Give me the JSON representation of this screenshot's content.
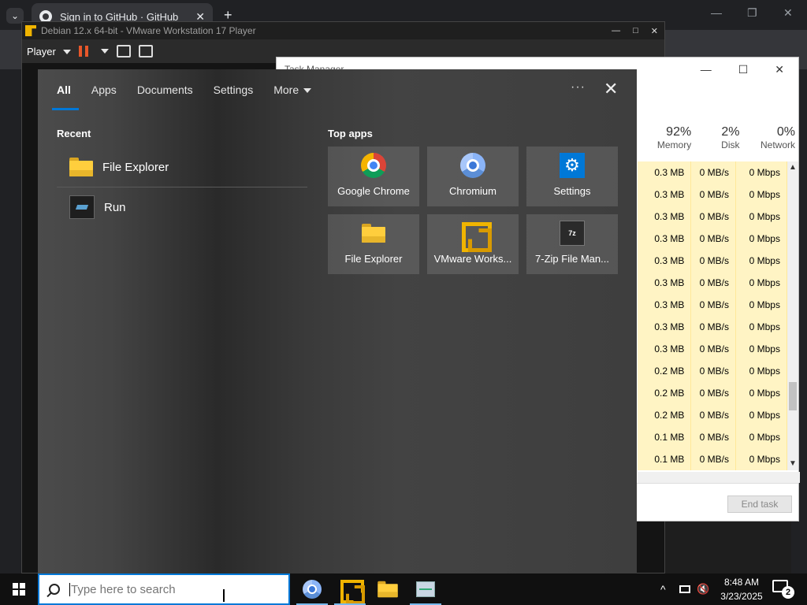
{
  "chrome": {
    "tab_title": "Sign in to GitHub · GitHub",
    "tab_close": "✕",
    "new_tab": "+",
    "tab_menu": "⌄",
    "minimize": "—",
    "restore": "❐",
    "close": "✕"
  },
  "vmware": {
    "title": "Debian 12.x 64-bit - VMware Workstation 17 Player",
    "player_menu": "Player",
    "minimize": "—",
    "maximize": "□",
    "close": "✕"
  },
  "task_manager": {
    "title": "Task Manager",
    "minimize": "—",
    "maximize": "☐",
    "close": "✕",
    "columns": [
      {
        "pct": "92%",
        "name": "Memory"
      },
      {
        "pct": "2%",
        "name": "Disk"
      },
      {
        "pct": "0%",
        "name": "Network"
      }
    ],
    "rows": [
      [
        "0.3 MB",
        "0 MB/s",
        "0 Mbps"
      ],
      [
        "0.3 MB",
        "0 MB/s",
        "0 Mbps"
      ],
      [
        "0.3 MB",
        "0 MB/s",
        "0 Mbps"
      ],
      [
        "0.3 MB",
        "0 MB/s",
        "0 Mbps"
      ],
      [
        "0.3 MB",
        "0 MB/s",
        "0 Mbps"
      ],
      [
        "0.3 MB",
        "0 MB/s",
        "0 Mbps"
      ],
      [
        "0.3 MB",
        "0 MB/s",
        "0 Mbps"
      ],
      [
        "0.3 MB",
        "0 MB/s",
        "0 Mbps"
      ],
      [
        "0.3 MB",
        "0 MB/s",
        "0 Mbps"
      ],
      [
        "0.2 MB",
        "0 MB/s",
        "0 Mbps"
      ],
      [
        "0.2 MB",
        "0 MB/s",
        "0 Mbps"
      ],
      [
        "0.2 MB",
        "0 MB/s",
        "0 Mbps"
      ],
      [
        "0.1 MB",
        "0 MB/s",
        "0 Mbps"
      ],
      [
        "0.1 MB",
        "0 MB/s",
        "0 Mbps"
      ]
    ],
    "end_task": "End task"
  },
  "start": {
    "tabs": [
      "All",
      "Apps",
      "Documents",
      "Settings",
      "More"
    ],
    "more_dots": "···",
    "close": "✕",
    "recent_title": "Recent",
    "recent": [
      {
        "label": "File Explorer",
        "icon": "folder-icon"
      },
      {
        "label": "Run",
        "icon": "run-icon"
      }
    ],
    "top_apps_title": "Top apps",
    "top_apps": [
      {
        "label": "Google Chrome",
        "icon": "chrome-icon"
      },
      {
        "label": "Chromium",
        "icon": "chromium-icon"
      },
      {
        "label": "Settings",
        "icon": "gear-icon"
      },
      {
        "label": "File Explorer",
        "icon": "folder-icon"
      },
      {
        "label": "VMware Works...",
        "icon": "vmware-icon"
      },
      {
        "label": "7-Zip File Man...",
        "icon": "7zip-icon"
      }
    ],
    "settings_glyph": "⚙",
    "zip_glyph": "7z"
  },
  "taskbar": {
    "search_placeholder": "Type here to search",
    "time": "8:48 AM",
    "date": "3/23/2025",
    "notification_count": "2",
    "tray_chevron": "^",
    "volume": "🔇"
  },
  "colors": {
    "accent": "#0078d7",
    "taskbar": "#101010",
    "tm_highlight": "#fff4c4"
  }
}
